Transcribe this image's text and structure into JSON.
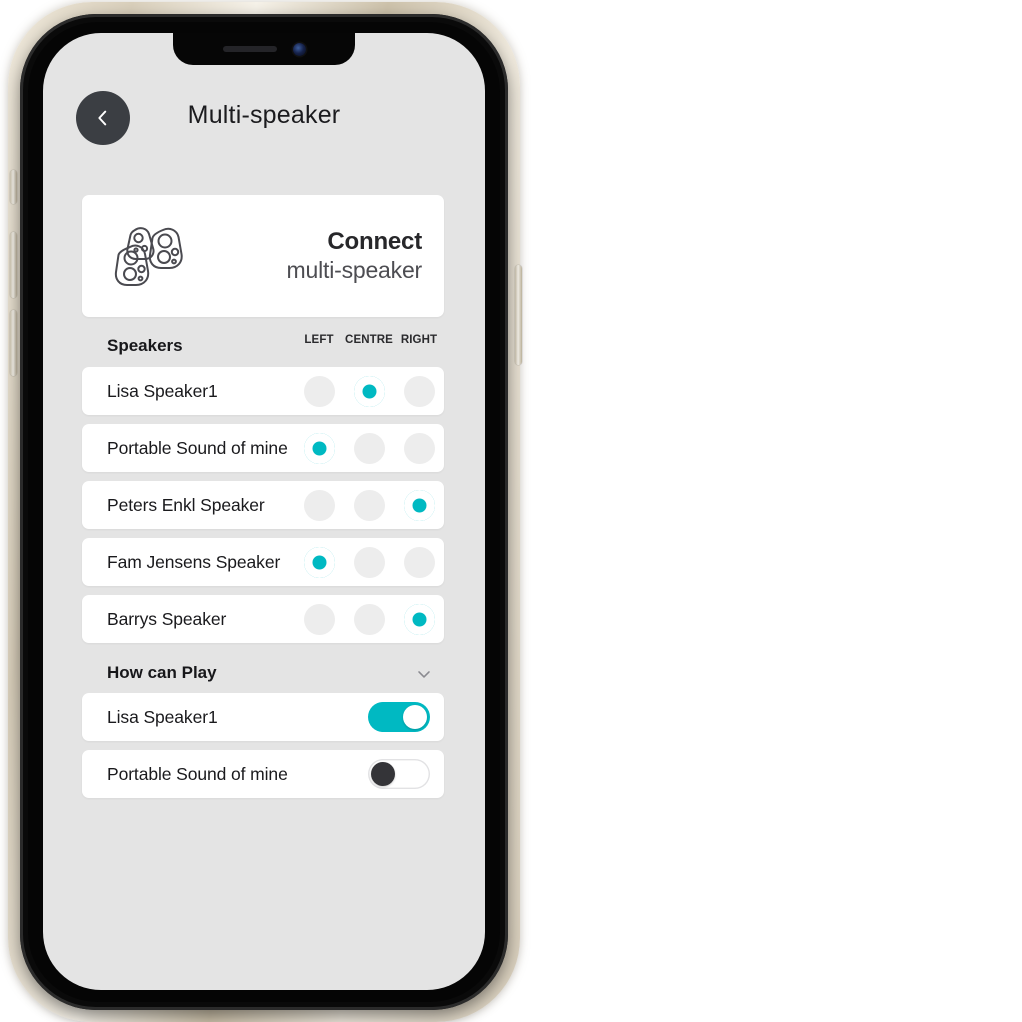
{
  "device": {
    "notch": {
      "speaker_icon": "speaker-grille-icon",
      "camera_icon": "front-camera-icon"
    }
  },
  "header": {
    "back_icon": "chevron-left-icon",
    "title": "Multi-speaker"
  },
  "connect_card": {
    "icon": "multi-speaker-icon",
    "title": "Connect",
    "subtitle": "multi-speaker"
  },
  "speakers_section": {
    "title": "Speakers",
    "columns": [
      "LEFT",
      "CENTRE",
      "RIGHT"
    ],
    "rows": [
      {
        "label": "Lisa Speaker1",
        "selected": "CENTRE"
      },
      {
        "label": "Portable Sound of mine",
        "selected": "LEFT"
      },
      {
        "label": "Peters Enkl Speaker",
        "selected": "RIGHT"
      },
      {
        "label": "Fam Jensens Speaker",
        "selected": "LEFT"
      },
      {
        "label": "Barrys Speaker",
        "selected": "RIGHT"
      }
    ]
  },
  "how_can_play_section": {
    "title": "How can Play",
    "expand_icon": "chevron-down-icon",
    "rows": [
      {
        "label": "Lisa Speaker1",
        "enabled": true
      },
      {
        "label": "Portable Sound of mine",
        "enabled": false
      }
    ]
  },
  "colors": {
    "accent": "#00b9c2",
    "screen_background": "#e4e4e4",
    "card": "#ffffff",
    "text_primary": "#1a1a1d",
    "back_button": "#3b3e43",
    "toggle_off_knob": "#343438",
    "radio_off": "#ededed"
  }
}
